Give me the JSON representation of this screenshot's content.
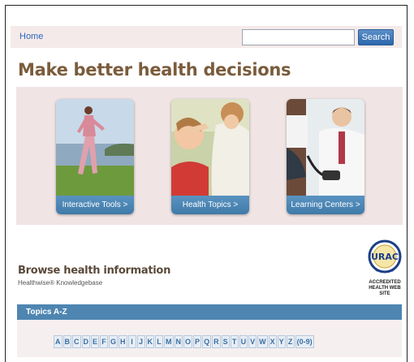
{
  "nav": {
    "home": "Home"
  },
  "search": {
    "placeholder": "",
    "button": "Search"
  },
  "page": {
    "title": "Make better health decisions"
  },
  "cards": [
    {
      "label": "Interactive Tools >"
    },
    {
      "label": "Health Topics >"
    },
    {
      "label": "Learning Centers >"
    }
  ],
  "browse": {
    "title": "Browse health information",
    "subtitle": "Healthwise® Knowledgebase"
  },
  "badge": {
    "logo": "URAC",
    "line1": "ACCREDITED",
    "line2": "HEALTH WEB SITE"
  },
  "topics": {
    "header": "Topics A-Z",
    "letters": [
      "A",
      "B",
      "C",
      "D",
      "E",
      "F",
      "G",
      "H",
      "I",
      "J",
      "K",
      "L",
      "M",
      "N",
      "O",
      "P",
      "Q",
      "R",
      "S",
      "T",
      "U",
      "V",
      "W",
      "X",
      "Y",
      "Z",
      "(0-9)"
    ]
  }
}
